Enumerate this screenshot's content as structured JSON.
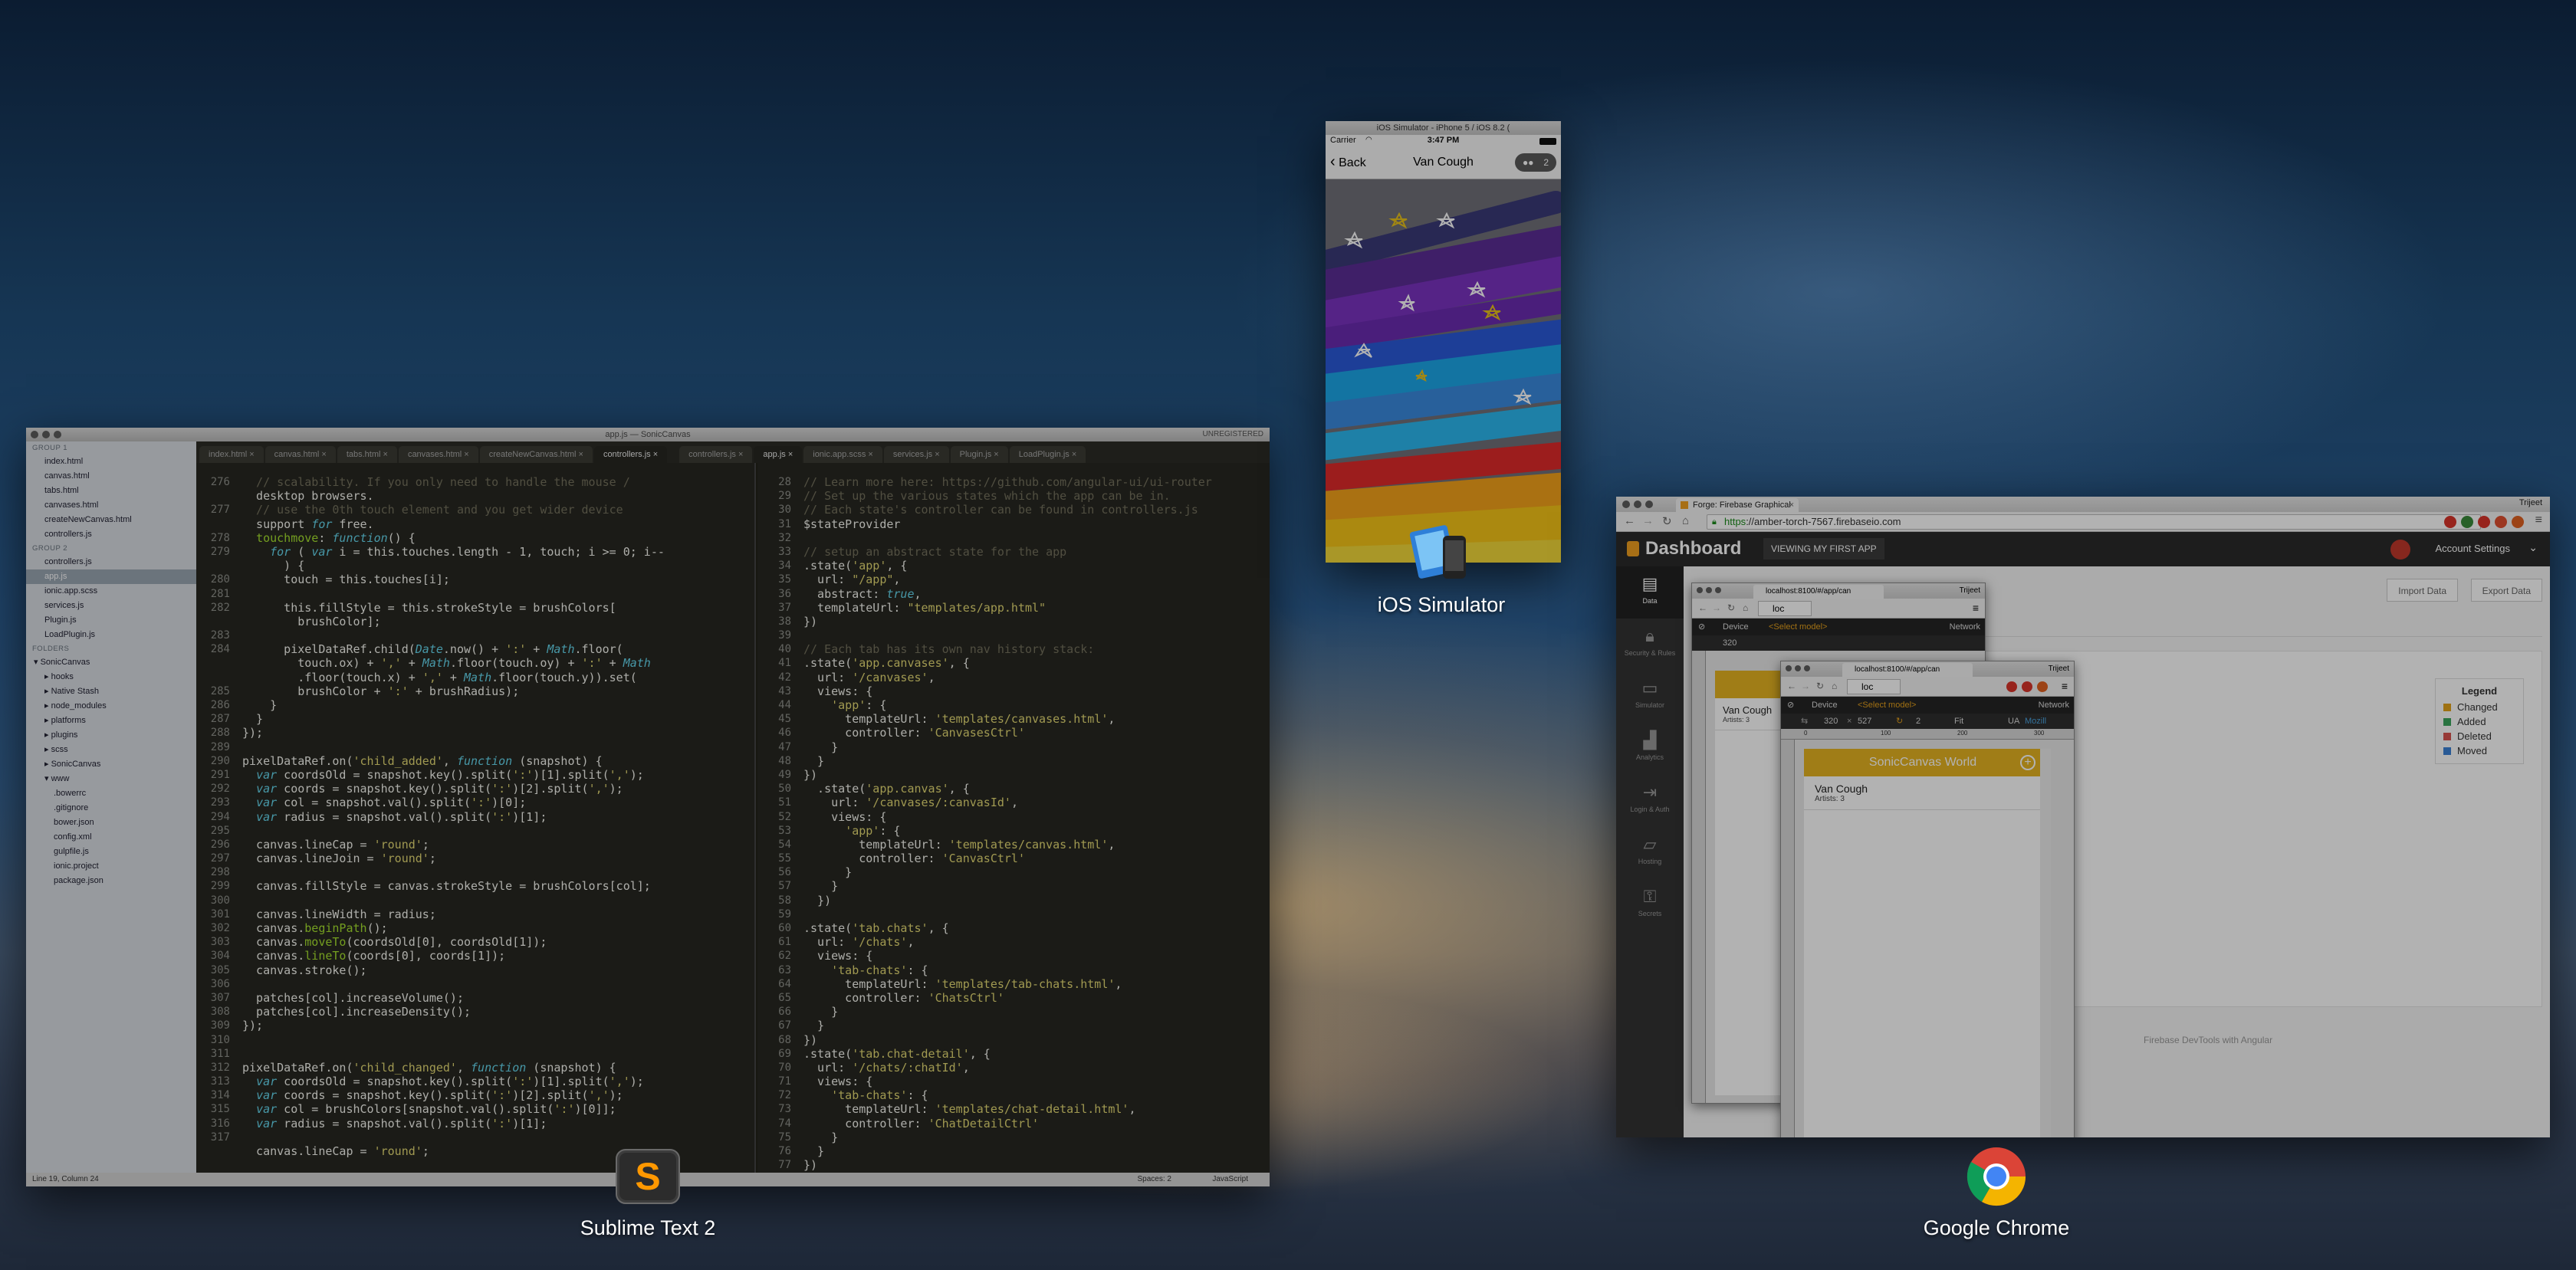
{
  "sublime": {
    "title": "app.js — SonicCanvas",
    "unregistered": "UNREGISTERED",
    "app_label": "Sublime Text 2",
    "tabs": [
      "index.html",
      "canvas.html",
      "tabs.html",
      "canvases.html",
      "createNewCanvas.html",
      "controllers.js",
      "controllers.js",
      "app.js",
      "ionic.app.scss",
      "services.js",
      "Plugin.js",
      "LoadPlugin.js"
    ],
    "sidebar": {
      "group1": "GROUP 1",
      "group1_items": [
        "index.html",
        "canvas.html",
        "tabs.html",
        "canvases.html",
        "createNewCanvas.html",
        "controllers.js"
      ],
      "group2": "GROUP 2",
      "group2_items": [
        "controllers.js",
        "app.js",
        "ionic.app.scss",
        "services.js",
        "Plugin.js",
        "LoadPlugin.js"
      ],
      "folders": "FOLDERS",
      "root": "SonicCanvas",
      "sub_folders": [
        "hooks",
        "Native Stash",
        "node_modules",
        "platforms",
        "plugins",
        "scss",
        "SonicCanvas",
        "www"
      ],
      "files": [
        ".bowerrc",
        ".gitignore",
        "bower.json",
        "config.xml",
        "gulpfile.js",
        "ionic.project",
        "package.json"
      ]
    },
    "pane1": {
      "lines": [
        "276",
        "",
        "277",
        "",
        "278",
        "279",
        "",
        "280",
        "281",
        "282",
        "",
        "283",
        "284",
        "",
        "",
        "285",
        "286",
        "287",
        "288",
        "289",
        "290",
        "291",
        "292",
        "293",
        "294",
        "295",
        "296",
        "297",
        "298",
        "299",
        "300",
        "301",
        "302",
        "303",
        "304",
        "305",
        "306",
        "307",
        "308",
        "309",
        "310",
        "311",
        "312",
        "313",
        "314",
        "315",
        "316",
        "317"
      ],
      "code": [
        "  // scalability. If you only need to handle the mouse /",
        "  desktop browsers.",
        "  // use the 0th touch element and you get wider device",
        "  support for free.",
        "  touchmove: function() {",
        "    for ( var i = this.touches.length - 1, touch; i >= 0; i--",
        "      ) {",
        "      touch = this.touches[i];",
        "",
        "      this.fillStyle = this.strokeStyle = brushColors[",
        "        brushColor];",
        "",
        "      pixelDataRef.child(Date.now() + ':' + Math.floor(",
        "        touch.ox) + ',' + Math.floor(touch.oy) + ':' + Math",
        "        .floor(touch.x) + ',' + Math.floor(touch.y)).set(",
        "        brushColor + ':' + brushRadius);",
        "    }",
        "  }",
        "});",
        "",
        "pixelDataRef.on('child_added', function (snapshot) {",
        "  var coordsOld = snapshot.key().split(':')[1].split(',');",
        "  var coords = snapshot.key().split(':')[2].split(',');",
        "  var col = snapshot.val().split(':')[0];",
        "  var radius = snapshot.val().split(':')[1];",
        "",
        "  canvas.lineCap = 'round';",
        "  canvas.lineJoin = 'round';",
        "",
        "  canvas.fillStyle = canvas.strokeStyle = brushColors[col];",
        "",
        "  canvas.lineWidth = radius;",
        "  canvas.beginPath();",
        "  canvas.moveTo(coordsOld[0], coordsOld[1]);",
        "  canvas.lineTo(coords[0], coords[1]);",
        "  canvas.stroke();",
        "",
        "  patches[col].increaseVolume();",
        "  patches[col].increaseDensity();",
        "});",
        "",
        "",
        "pixelDataRef.on('child_changed', function (snapshot) {",
        "  var coordsOld = snapshot.key().split(':')[1].split(',');",
        "  var coords = snapshot.key().split(':')[2].split(',');",
        "  var col = brushColors[snapshot.val().split(':')[0]];",
        "  var radius = snapshot.val().split(':')[1];",
        "",
        "  canvas.lineCap = 'round';"
      ]
    },
    "pane2": {
      "lines": [
        "28",
        "29",
        "30",
        "31",
        "32",
        "33",
        "34",
        "35",
        "36",
        "37",
        "38",
        "39",
        "40",
        "41",
        "42",
        "43",
        "44",
        "45",
        "46",
        "47",
        "48",
        "49",
        "50",
        "51",
        "52",
        "53",
        "54",
        "55",
        "56",
        "57",
        "58",
        "59",
        "60",
        "61",
        "62",
        "63",
        "64",
        "65",
        "66",
        "67",
        "68",
        "69",
        "70",
        "71",
        "72",
        "73",
        "74",
        "75",
        "76",
        "77"
      ],
      "code": [
        "// Learn more here: https://github.com/angular-ui/ui-router",
        "// Set up the various states which the app can be in.",
        "// Each state's controller can be found in controllers.js",
        "$stateProvider",
        "",
        "// setup an abstract state for the app",
        ".state('app', {",
        "  url: \"/app\",",
        "  abstract: true,",
        "  templateUrl: \"templates/app.html\"",
        "})",
        "",
        "// Each tab has its own nav history stack:",
        ".state('app.canvases', {",
        "  url: '/canvases',",
        "  views: {",
        "    'app': {",
        "      templateUrl: 'templates/canvases.html',",
        "      controller: 'CanvasesCtrl'",
        "    }",
        "  }",
        "})",
        "  .state('app.canvas', {",
        "    url: '/canvases/:canvasId',",
        "    views: {",
        "      'app': {",
        "        templateUrl: 'templates/canvas.html',",
        "        controller: 'CanvasCtrl'",
        "      }",
        "    }",
        "  })",
        "",
        ".state('tab.chats', {",
        "  url: '/chats',",
        "  views: {",
        "    'tab-chats': {",
        "      templateUrl: 'templates/tab-chats.html',",
        "      controller: 'ChatsCtrl'",
        "    }",
        "  }",
        "})",
        ".state('tab.chat-detail', {",
        "  url: '/chats/:chatId',",
        "  views: {",
        "    'tab-chats': {",
        "      templateUrl: 'templates/chat-detail.html',",
        "      controller: 'ChatDetailCtrl'",
        "    }",
        "  }",
        "})"
      ]
    },
    "status_left": "Line 19, Column 24",
    "status_spaces": "Spaces: 2",
    "status_syntax": "JavaScript"
  },
  "ios": {
    "title": "iOS Simulator - iPhone 5 / iOS 8.2 (",
    "carrier": "Carrier",
    "time": "3:47 PM",
    "back": "Back",
    "nav_title": "Van Cough",
    "badge_count": "2",
    "app_label": "iOS Simulator"
  },
  "chrome": {
    "tab_title": "Forge: Firebase Graphical",
    "user": "Trijeet",
    "url_secure": "https",
    "url_rest": "://amber-torch-7567.firebaseio.com",
    "brand": "Dashboard",
    "app_tab": "VIEWING MY FIRST APP",
    "account": "Account Settings",
    "sidebar": [
      "Data",
      "Security & Rules",
      "Simulator",
      "Analytics",
      "Login & Auth",
      "Hosting",
      "Secrets"
    ],
    "import": "Import Data",
    "export": "Export Data",
    "legend_title": "Legend",
    "legend": [
      {
        "label": "Changed",
        "color": "#e3a21a"
      },
      {
        "label": "Added",
        "color": "#3ba55c"
      },
      {
        "label": "Deleted",
        "color": "#d9534f"
      },
      {
        "label": "Moved",
        "color": "#3b82d6"
      }
    ],
    "footer": "Firebase DevTools with Angular",
    "app_label": "Google Chrome"
  },
  "devtools1": {
    "tab": "localhost:8100/#/app/can",
    "user": "Trijeet",
    "url": "loc",
    "device": "Device",
    "select": "<Select model>",
    "network": "Network",
    "width": "320",
    "item_title": "Van Cough",
    "item_sub": "Artists: 3"
  },
  "devtools2": {
    "tab": "localhost:8100/#/app/can",
    "user": "Trijeet",
    "url": "loc",
    "device": "Device",
    "select": "<Select model>",
    "network": "Network",
    "width": "320",
    "height": "527",
    "scale": "2",
    "fit": "Fit",
    "ua": "UA",
    "ua_val": "Mozill",
    "ruler": [
      "0",
      "100",
      "200",
      "300"
    ],
    "app_bar": "SonicCanvas World",
    "item_title": "Van Cough",
    "item_sub": "Artists: 3"
  }
}
